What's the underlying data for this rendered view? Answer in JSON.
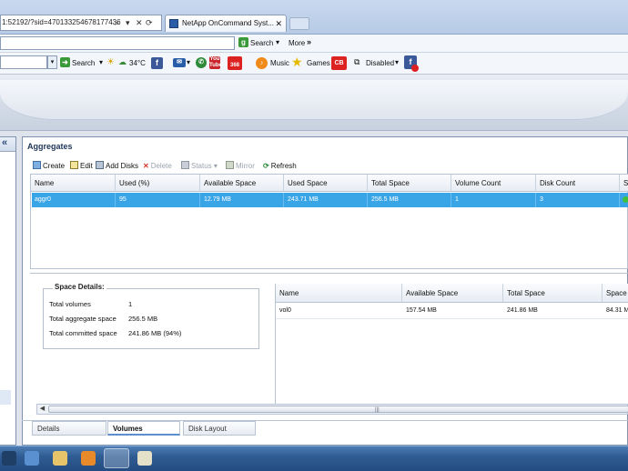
{
  "browser": {
    "address": "1:52192/?sid=470133254678177436",
    "tab_title": "NetApp OnCommand Syst...",
    "toolbar1": {
      "search_label": "Search",
      "more_label": "More"
    },
    "toolbar2": {
      "search_label": "Search",
      "weather": "34°C",
      "music_label": "Music",
      "games_label": "Games",
      "disabled_label": "Disabled"
    }
  },
  "panel": {
    "title": "Aggregates",
    "toolbar": {
      "create": "Create",
      "edit": "Edit",
      "add_disks": "Add Disks",
      "delete": "Delete",
      "status": "Status",
      "mirror": "Mirror",
      "refresh": "Refresh"
    },
    "columns": [
      "Name",
      "Used (%)",
      "Available Space",
      "Used Space",
      "Total Space",
      "Volume Count",
      "Disk Count",
      "S"
    ],
    "rows": [
      [
        "aggr0",
        "95",
        "12.79 MB",
        "243.71 MB",
        "256.5 MB",
        "1",
        "3",
        ""
      ]
    ]
  },
  "space_details": {
    "legend": "Space Details:",
    "items": [
      {
        "label": "Total volumes",
        "value": "1"
      },
      {
        "label": "Total aggregate space",
        "value": "256.5 MB"
      },
      {
        "label": "Total committed space",
        "value": "241.86 MB (94%)"
      }
    ]
  },
  "volumes": {
    "columns": [
      "Name",
      "Available Space",
      "Total Space",
      "Space U"
    ],
    "rows": [
      [
        "vol0",
        "157.54 MB",
        "241.86 MB",
        "84.31 M"
      ]
    ],
    "scroll_grip": "|||"
  },
  "bottom_tabs": [
    "Details",
    "Volumes",
    "Disk Layout"
  ],
  "active_tab": "Volumes",
  "colors": {
    "selection": "#3aa5e6",
    "taskbar": "#2f5c93",
    "title": "#1d3557"
  }
}
